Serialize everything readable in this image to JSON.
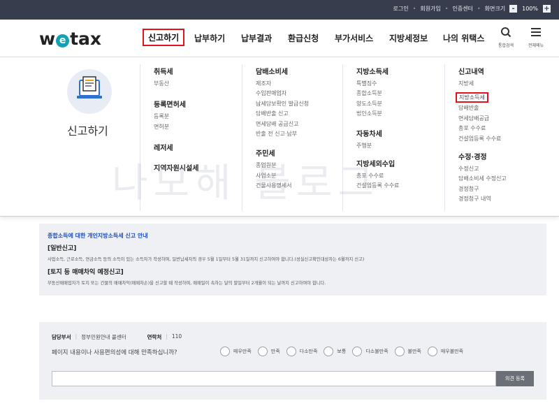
{
  "util": {
    "login": "로그인",
    "signup": "회원가입",
    "support": "인증센터",
    "zoom_label": "화면크기",
    "zoom_minus": "-",
    "zoom_value": "100%",
    "zoom_plus": "+"
  },
  "logo": {
    "w": "w",
    "e": "e",
    "rest": "tax"
  },
  "gnb": [
    "신고하기",
    "납부하기",
    "납부결과",
    "환급신청",
    "부가서비스",
    "지방세정보",
    "나의 위택스"
  ],
  "header_icons": {
    "search": "통합검색",
    "menu": "전체메뉴"
  },
  "mega": {
    "section_title": "신고하기",
    "watermark": "나모해 블로그",
    "col1": [
      {
        "heading": "취득세",
        "items": [
          "부동산"
        ]
      },
      {
        "heading": "등록면허세",
        "items": [
          "등록분",
          "면허분"
        ]
      },
      {
        "heading": "레저세",
        "items": []
      },
      {
        "heading": "지역자원시설세",
        "items": []
      }
    ],
    "col2": [
      {
        "heading": "담배소비세",
        "items": [
          "제조자",
          "수입판매업자",
          "납세담보확인 발급신청",
          "담배반출 신고",
          "면세담배 공급신고",
          "반출 전 신고·납부"
        ]
      },
      {
        "heading": "주민세",
        "items": [
          "종업원분",
          "사업소분",
          "건물사용명세서"
        ]
      }
    ],
    "col3": [
      {
        "heading": "지방소득세",
        "items": [
          "특별징수",
          "종합소득분",
          "양도소득분",
          "법인소득분"
        ]
      },
      {
        "heading": "자동차세",
        "items": [
          "주행분"
        ]
      },
      {
        "heading": "지방세외수입",
        "items": [
          "총포 수수료",
          "건설업등록 수수료"
        ]
      }
    ],
    "col4": [
      {
        "heading": "신고내역",
        "items": [
          "지방세",
          "지방소득세",
          "담배반출",
          "면세담배공급",
          "총포 수수료",
          "건설업등록 수수료"
        ]
      },
      {
        "heading": "수정·경정",
        "items": [
          "수정신고",
          "담배소비세 수정신고",
          "경정청구",
          "경정청구 내역"
        ]
      }
    ]
  },
  "info": {
    "title": "종합소득에 대한 개인지방소득세 신고 안내",
    "h1": "[일반신고]",
    "p1": "사업소득, 근로소득, 연금소득 등의 소득이 있는 소득자가 작성하며, 일반납세자의 경우 5월 1일부터 5월 31일까지 신고하여야 합니다.(성실신고확인대상자는 6월까지 신고)",
    "h2": "[토지 등 매매차익 예정신고]",
    "p2": "부동산매매업자가 토지 또는 건물의 매매차익(매매차손)을 신고할 때 작성하며, 매매일이 속하는 달의 말일부터 2개월이 되는 날까지 신고하여야 합니다."
  },
  "survey": {
    "dept_label": "담당부서",
    "dept_value": "정부민원안내 콜센터",
    "contact_label": "연락처",
    "contact_value": "110",
    "question": "페이지 내용이나 사용편의성에 대해 만족하십니까?",
    "options": [
      "매우만족",
      "만족",
      "다소만족",
      "보통",
      "다소불만족",
      "불만족",
      "매우불만족"
    ],
    "submit": "의견 등록"
  },
  "colors": {
    "topbar": "#383d4e",
    "highlight": "#e0141e",
    "accent": "#15a0b4",
    "info_title": "#1f4fc1"
  }
}
